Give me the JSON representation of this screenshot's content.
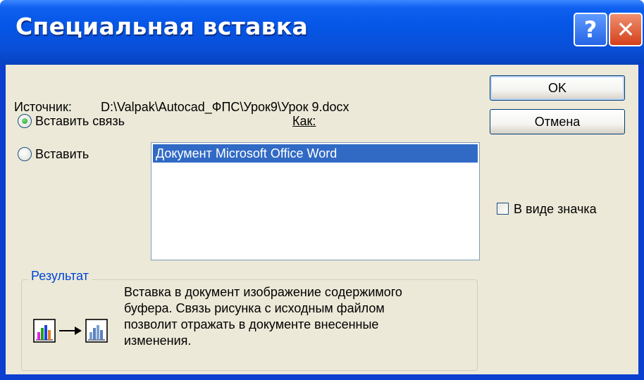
{
  "window": {
    "title": "Специальная вставка",
    "help_glyph": "?",
    "close_glyph": "✕"
  },
  "source": {
    "label": "Источник:",
    "path": "D:\\Valpak\\Autocad_ФПС\\Урок9\\Урок 9.docx"
  },
  "options": {
    "paste_link": {
      "label": "Вставить связь",
      "selected": true
    },
    "paste": {
      "label": "Вставить",
      "selected": false
    }
  },
  "as_label": "Как:",
  "list": {
    "items": [
      "Документ Microsoft Office Word"
    ],
    "selected_index": 0
  },
  "buttons": {
    "ok": "OK",
    "cancel": "Отмена"
  },
  "display_as_icon": {
    "label": "В виде значка",
    "checked": false
  },
  "result": {
    "title": "Результат",
    "text": "Вставка в документ изображение содержимого буфера.  Связь рисунка с исходным файлом позволит отражать в документе внесенные изменения.",
    "icon_left": "document-chart-icon",
    "icon_arrow": "→",
    "icon_right": "linked-chart-icon"
  },
  "colors": {
    "titlebar": "#0556e6",
    "selection": "#316ac5",
    "group_label": "#0046d5",
    "dialog_bg": "#ece9d8"
  }
}
